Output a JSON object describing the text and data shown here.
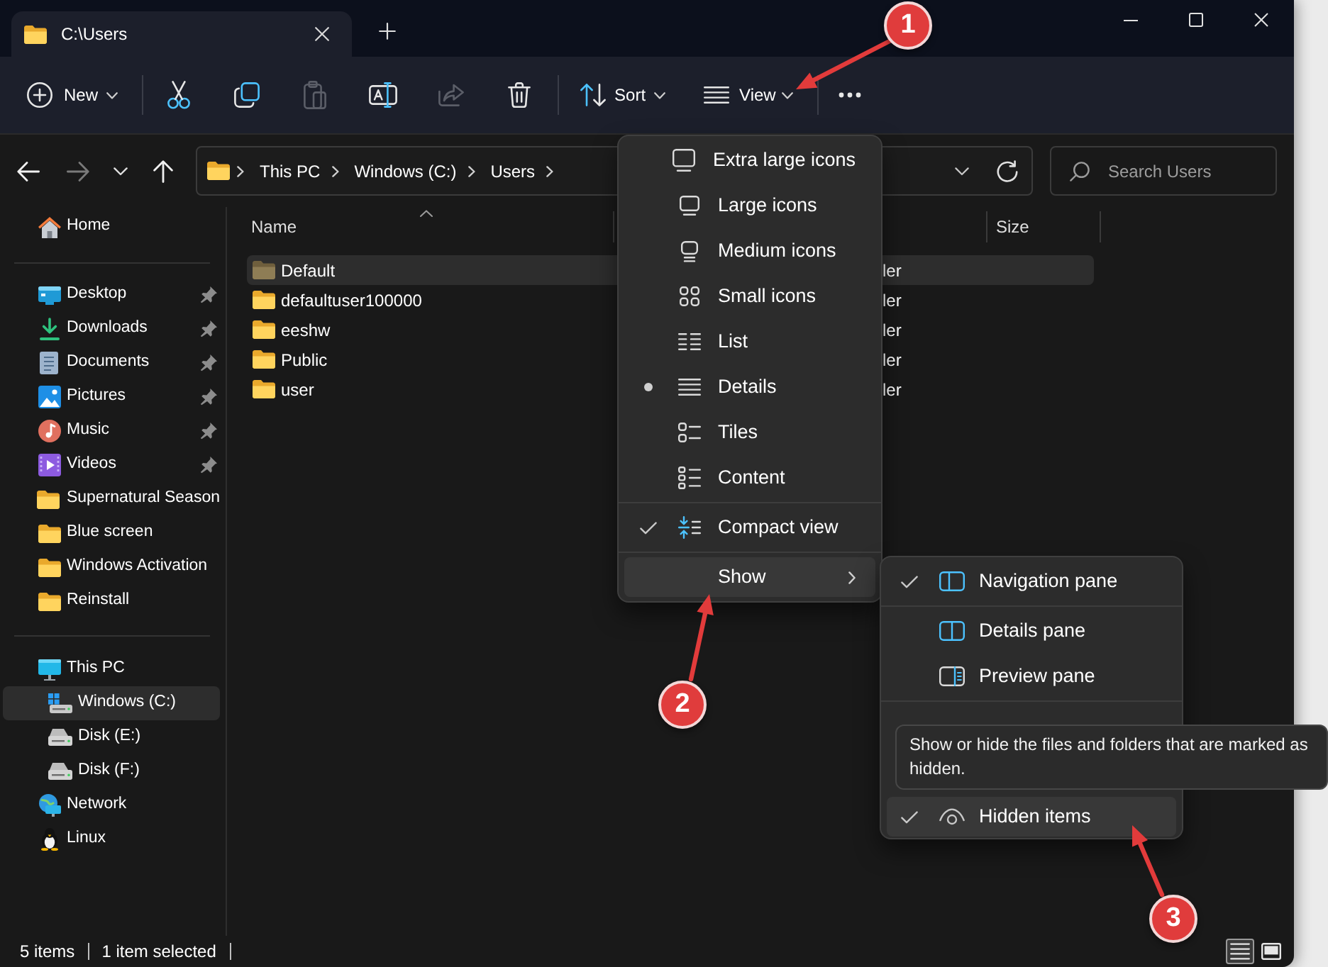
{
  "tabs": [
    {
      "label": "C:\\Users",
      "selected": true
    }
  ],
  "toolbar": {
    "new": {
      "label": "New"
    },
    "actions": [
      {
        "disabled": false
      },
      {
        "disabled": false
      },
      {
        "disabled": true
      },
      {
        "disabled": false
      },
      {
        "disabled": true
      },
      {
        "disabled": false
      }
    ],
    "sort": {
      "label": "Sort"
    },
    "view": {
      "label": "View"
    }
  },
  "navigation": {
    "back": {
      "disabled": false
    },
    "forward": {
      "disabled": true
    }
  },
  "address_bar": {
    "crumbs": [
      "This PC",
      "Windows (C:)",
      "Users"
    ]
  },
  "search": {
    "placeholder": "Search Users"
  },
  "sidebar": {
    "sections": [
      {
        "items": [
          {
            "label": "Home",
            "pinned": false,
            "selected": false
          }
        ]
      },
      {
        "items": [
          {
            "label": "Desktop",
            "pinned": true,
            "selected": false
          },
          {
            "label": "Downloads",
            "pinned": true,
            "selected": false
          },
          {
            "label": "Documents",
            "pinned": true,
            "selected": false
          },
          {
            "label": "Pictures",
            "pinned": true,
            "selected": false
          },
          {
            "label": "Music",
            "pinned": true,
            "selected": false
          },
          {
            "label": "Videos",
            "pinned": true,
            "selected": false
          },
          {
            "label": "Supernatural Season",
            "pinned": false,
            "selected": false
          },
          {
            "label": "Blue screen",
            "pinned": false,
            "selected": false
          },
          {
            "label": "Windows Activation",
            "pinned": false,
            "selected": false
          },
          {
            "label": "Reinstall",
            "pinned": false,
            "selected": false
          }
        ]
      },
      {
        "items": [
          {
            "label": "This PC",
            "pinned": false,
            "selected": false,
            "children": [
              {
                "label": "Windows (C:)",
                "pinned": false,
                "selected": true
              },
              {
                "label": "Disk (E:)",
                "pinned": false,
                "selected": false
              },
              {
                "label": "Disk (F:)",
                "pinned": false,
                "selected": false
              }
            ]
          },
          {
            "label": "Network",
            "pinned": false,
            "selected": false
          },
          {
            "label": "Linux",
            "pinned": false,
            "selected": false
          }
        ]
      }
    ]
  },
  "file_list": {
    "columns": [
      {
        "label": "Name",
        "sorted": true
      },
      {
        "label": "Size",
        "sorted": false
      }
    ],
    "rows": [
      {
        "name": "Default",
        "column_2": "ler",
        "selected": true,
        "hidden": true
      },
      {
        "name": "defaultuser100000",
        "column_2": "ler",
        "selected": false,
        "hidden": false
      },
      {
        "name": "eeshw",
        "column_2": "ler",
        "selected": false,
        "hidden": false
      },
      {
        "name": "Public",
        "column_2": "ler",
        "selected": false,
        "hidden": false
      },
      {
        "name": "user",
        "column_2": "ler",
        "selected": false,
        "hidden": false
      }
    ]
  },
  "view_menu": {
    "sections": [
      {
        "items": [
          {
            "kind": "radio",
            "label": "Extra large icons",
            "selected": false
          },
          {
            "kind": "radio",
            "label": "Large icons",
            "selected": false
          },
          {
            "kind": "radio",
            "label": "Medium icons",
            "selected": false
          },
          {
            "kind": "radio",
            "label": "Small icons",
            "selected": false
          },
          {
            "kind": "radio",
            "label": "List",
            "selected": false
          },
          {
            "kind": "radio",
            "label": "Details",
            "selected": true
          },
          {
            "kind": "radio",
            "label": "Tiles",
            "selected": false
          },
          {
            "kind": "radio",
            "label": "Content",
            "selected": false
          }
        ]
      },
      {
        "items": [
          {
            "kind": "toggle",
            "label": "Compact view",
            "checked": true
          }
        ]
      },
      {
        "items": [
          {
            "kind": "submenu",
            "label": "Show",
            "highlighted": true
          }
        ]
      }
    ]
  },
  "show_menu": {
    "sections": [
      {
        "items": [
          {
            "label": "Navigation pane",
            "checked": true,
            "highlighted": false
          }
        ]
      },
      {
        "items": [
          {
            "label": "Details pane",
            "checked": false,
            "highlighted": false
          },
          {
            "label": "Preview pane",
            "checked": false,
            "highlighted": false
          }
        ]
      },
      {
        "items": [
          {
            "label": "Hidden items",
            "checked": true,
            "highlighted": true
          }
        ]
      }
    ]
  },
  "tooltip": {
    "text": "Show or hide the files and folders that are marked as hidden."
  },
  "status_bar": {
    "item_count": "5 items",
    "selection": "1 item selected",
    "views": [
      {
        "selected": true
      },
      {
        "selected": false
      }
    ]
  },
  "annotations": [
    {
      "label": "1"
    },
    {
      "label": "2"
    },
    {
      "label": "3"
    }
  ]
}
